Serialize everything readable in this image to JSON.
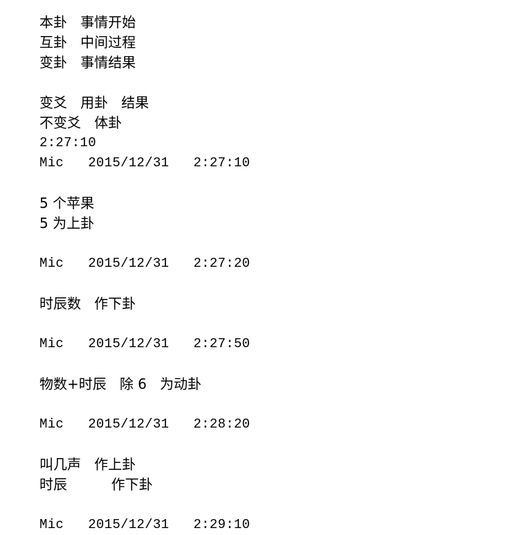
{
  "document": {
    "background_color": "#ffffff",
    "text_color": "#000000",
    "blocks": [
      {
        "name": "gua-definitions",
        "lines": [
          {
            "kind": "cjk",
            "text": "本卦   事情开始"
          },
          {
            "kind": "cjk",
            "text": "互卦   中间过程"
          },
          {
            "kind": "cjk",
            "text": "变卦   事情结果"
          }
        ]
      },
      {
        "name": "yao-definitions-and-first-recording",
        "lines": [
          {
            "kind": "cjk",
            "text": "变爻   用卦   结果"
          },
          {
            "kind": "cjk",
            "text": "不变爻   体卦"
          },
          {
            "kind": "mono",
            "text": "2:27:10"
          },
          {
            "kind": "mono",
            "text": "Mic   2015/12/31   2:27:10"
          }
        ]
      },
      {
        "name": "apples-upper-trigram",
        "lines": [
          {
            "kind": "cjk-num",
            "text": "5 个苹果"
          },
          {
            "kind": "cjk-num",
            "text": "5 为上卦"
          }
        ]
      },
      {
        "name": "recording-2-27-20",
        "lines": [
          {
            "kind": "mono",
            "text": "Mic   2015/12/31   2:27:20"
          }
        ]
      },
      {
        "name": "shichen-lower-trigram",
        "lines": [
          {
            "kind": "cjk",
            "text": "时辰数   作下卦"
          }
        ]
      },
      {
        "name": "recording-2-27-50",
        "lines": [
          {
            "kind": "mono",
            "text": "Mic   2015/12/31   2:27:50"
          }
        ]
      },
      {
        "name": "moving-line-formula",
        "lines": [
          {
            "kind": "cjk",
            "text": "物数+时辰   除 6   为动卦"
          }
        ]
      },
      {
        "name": "recording-2-28-20",
        "lines": [
          {
            "kind": "mono",
            "text": "Mic   2015/12/31   2:28:20"
          }
        ]
      },
      {
        "name": "calls-and-shichen-trigrams",
        "lines": [
          {
            "kind": "cjk",
            "text": "叫几声   作上卦"
          },
          {
            "kind": "cjk",
            "text": "时辰          作下卦"
          }
        ]
      },
      {
        "name": "recording-2-29-10",
        "lines": [
          {
            "kind": "mono",
            "text": "Mic   2015/12/31   2:29:10"
          }
        ]
      }
    ]
  }
}
